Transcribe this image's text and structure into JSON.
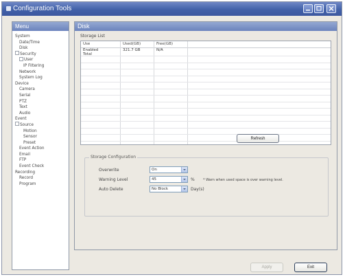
{
  "window": {
    "title": "Configuration Tools"
  },
  "menu": {
    "header": "Menu",
    "items": [
      {
        "label": "System",
        "indent": 0,
        "toggle": false
      },
      {
        "label": "Date/Time",
        "indent": 1,
        "toggle": false
      },
      {
        "label": "Disk",
        "indent": 1,
        "toggle": false
      },
      {
        "label": "Security",
        "indent": 0,
        "toggle": true
      },
      {
        "label": "User",
        "indent": 1,
        "toggle": true
      },
      {
        "label": "IP Filtering",
        "indent": 2,
        "toggle": false
      },
      {
        "label": "Network",
        "indent": 1,
        "toggle": false
      },
      {
        "label": "System Log",
        "indent": 1,
        "toggle": false
      },
      {
        "label": "Device",
        "indent": 0,
        "toggle": false
      },
      {
        "label": "Camera",
        "indent": 1,
        "toggle": false
      },
      {
        "label": "Serial",
        "indent": 1,
        "toggle": false
      },
      {
        "label": "PTZ",
        "indent": 1,
        "toggle": false
      },
      {
        "label": "Text",
        "indent": 1,
        "toggle": false
      },
      {
        "label": "Audio",
        "indent": 1,
        "toggle": false
      },
      {
        "label": "Event",
        "indent": 0,
        "toggle": false
      },
      {
        "label": "Source",
        "indent": 0,
        "toggle": true
      },
      {
        "label": "Motion",
        "indent": 2,
        "toggle": false
      },
      {
        "label": "Sensor",
        "indent": 2,
        "toggle": false
      },
      {
        "label": "Preset",
        "indent": 2,
        "toggle": false
      },
      {
        "label": "Event Action",
        "indent": 1,
        "toggle": false
      },
      {
        "label": "Email",
        "indent": 1,
        "toggle": false
      },
      {
        "label": "FTP",
        "indent": 1,
        "toggle": false
      },
      {
        "label": "Event Check",
        "indent": 1,
        "toggle": false
      },
      {
        "label": "Recording",
        "indent": 0,
        "toggle": false
      },
      {
        "label": "Record",
        "indent": 1,
        "toggle": false
      },
      {
        "label": "Program",
        "indent": 1,
        "toggle": false
      }
    ]
  },
  "main": {
    "header": "Disk",
    "storage_list_label": "Storage List",
    "columns": [
      "Use",
      "Used(GB)",
      "Free(GB)"
    ],
    "rows": [
      [
        "Enabled",
        "321.7 GB",
        "N/A"
      ],
      [
        "Total",
        "",
        ""
      ]
    ],
    "refresh_label": "Refresh",
    "config": {
      "title": "Storage Configuration",
      "overwrite_label": "Overwrite",
      "overwrite_value": "On",
      "warning_label": "Warning Level",
      "warning_value": "45",
      "warning_unit": "%",
      "warning_note": "* Warn when used space is over warning level.",
      "auto_delete_label": "Auto Delete",
      "auto_delete_value": "No Block",
      "auto_delete_unit": "Day(s)"
    }
  },
  "footer": {
    "apply_label": "Apply",
    "exit_label": "Exit"
  }
}
